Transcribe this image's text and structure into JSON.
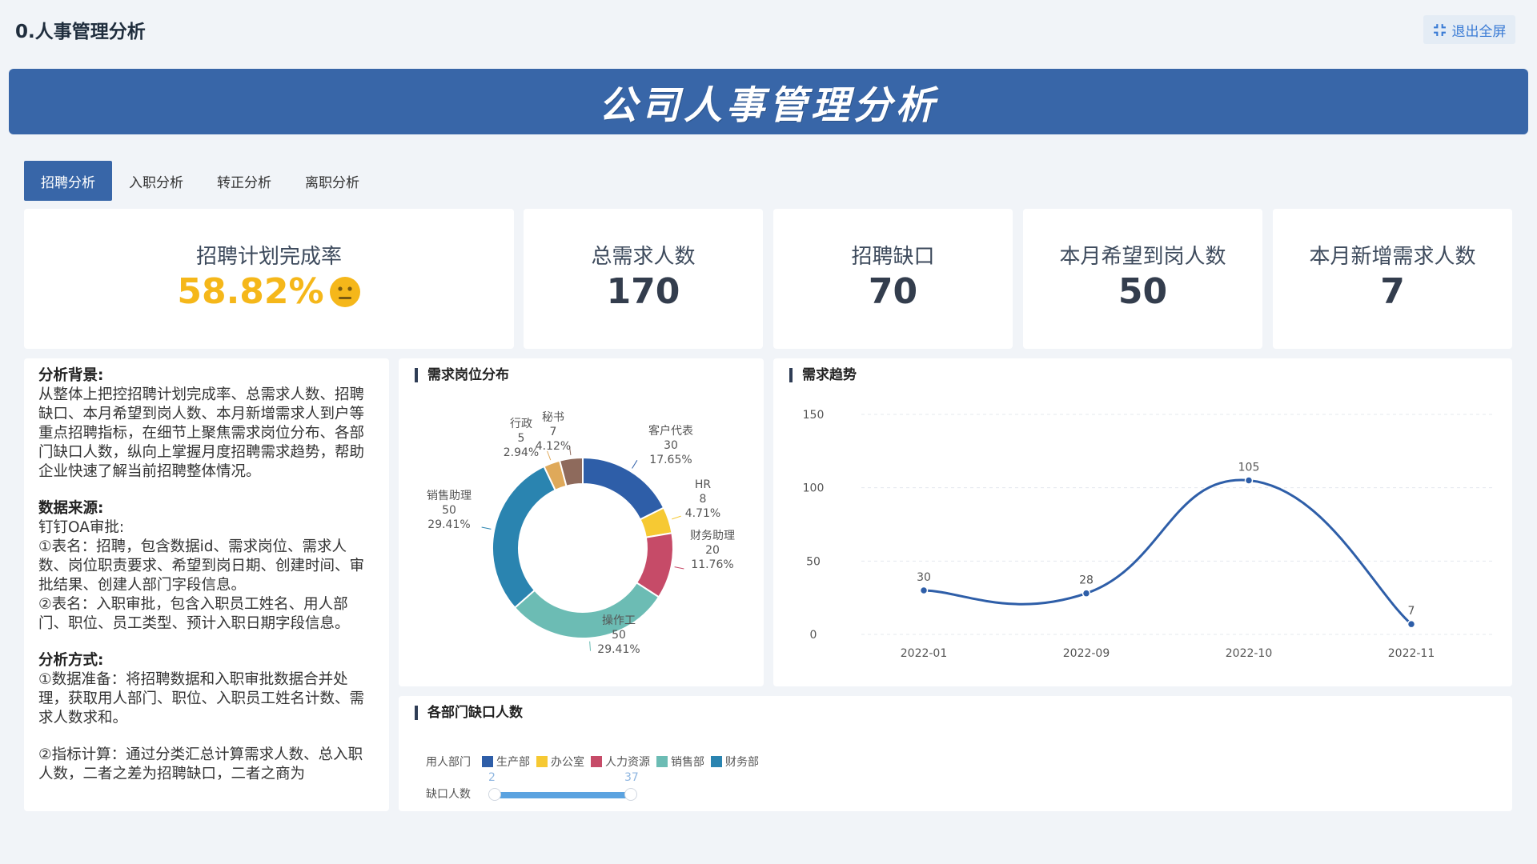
{
  "page_title": "0.人事管理分析",
  "exit_button": "退出全屏",
  "banner_title": "公司人事管理分析",
  "tabs": [
    "招聘分析",
    "入职分析",
    "转正分析",
    "离职分析"
  ],
  "kpis": {
    "completion_rate": {
      "label": "招聘计划完成率",
      "value": "58.82%"
    },
    "total_demand": {
      "label": "总需求人数",
      "value": "170"
    },
    "gap": {
      "label": "招聘缺口",
      "value": "70"
    },
    "expected_arrival": {
      "label": "本月希望到岗人数",
      "value": "50"
    },
    "new_demand": {
      "label": "本月新增需求人数",
      "value": "7"
    }
  },
  "analysis": {
    "background_title": "分析背景:",
    "background_text": "从整体上把控招聘计划完成率、总需求人数、招聘缺口、本月希望到岗人数、本月新增需求人到户等重点招聘指标，在细节上聚焦需求岗位分布、各部门缺口人数，纵向上掌握月度招聘需求趋势，帮助企业快速了解当前招聘整体情况。",
    "source_title": "数据来源:",
    "source_text": "钉钉OA审批:\n①表名：招聘，包含数据id、需求岗位、需求人数、岗位职责要求、希望到岗日期、创建时间、审批结果、创建人部门字段信息。\n②表名：入职审批，包含入职员工姓名、用人部门、职位、员工类型、预计入职日期字段信息。",
    "method_title": "分析方式:",
    "method_text_1": "①数据准备：将招聘数据和入职审批数据合并处理，获取用人部门、职位、入职员工姓名计数、需求人数求和。",
    "method_text_2": "②指标计算：通过分类汇总计算需求人数、总入职人数，二者之差为招聘缺口，二者之商为"
  },
  "donut": {
    "title": "需求岗位分布",
    "slices": [
      {
        "name": "客户代表",
        "value": 30,
        "pct": "17.65%",
        "color": "#2e5ea8"
      },
      {
        "name": "HR",
        "value": 8,
        "pct": "4.71%",
        "color": "#f6c933"
      },
      {
        "name": "财务助理",
        "value": 20,
        "pct": "11.76%",
        "color": "#c64b68"
      },
      {
        "name": "操作工",
        "value": 50,
        "pct": "29.41%",
        "color": "#6cbcb4"
      },
      {
        "name": "销售助理",
        "value": 50,
        "pct": "29.41%",
        "color": "#2a84b0"
      },
      {
        "name": "行政",
        "value": 5,
        "pct": "2.94%",
        "color": "#dfa95a"
      },
      {
        "name": "秘书",
        "value": 7,
        "pct": "4.12%",
        "color": "#8e6a5c"
      }
    ]
  },
  "trend": {
    "title": "需求趋势",
    "chart_data": {
      "type": "line",
      "x": [
        "2022-01",
        "2022-09",
        "2022-10",
        "2022-11"
      ],
      "values": [
        30,
        28,
        105,
        7
      ],
      "yticks": [
        0,
        50,
        100,
        150
      ],
      "ylim": [
        0,
        150
      ],
      "color": "#2e5ea8"
    }
  },
  "dept_gap": {
    "title": "各部门缺口人数",
    "legend_label": "用人部门",
    "legend": [
      {
        "name": "生产部",
        "color": "#2e5ea8"
      },
      {
        "name": "办公室",
        "color": "#f6c933"
      },
      {
        "name": "人力资源",
        "color": "#c64b68"
      },
      {
        "name": "销售部",
        "color": "#6cbcb4"
      },
      {
        "name": "财务部",
        "color": "#2a84b0"
      }
    ],
    "slider_label": "缺口人数",
    "slider_min": "2",
    "slider_max": "37"
  }
}
